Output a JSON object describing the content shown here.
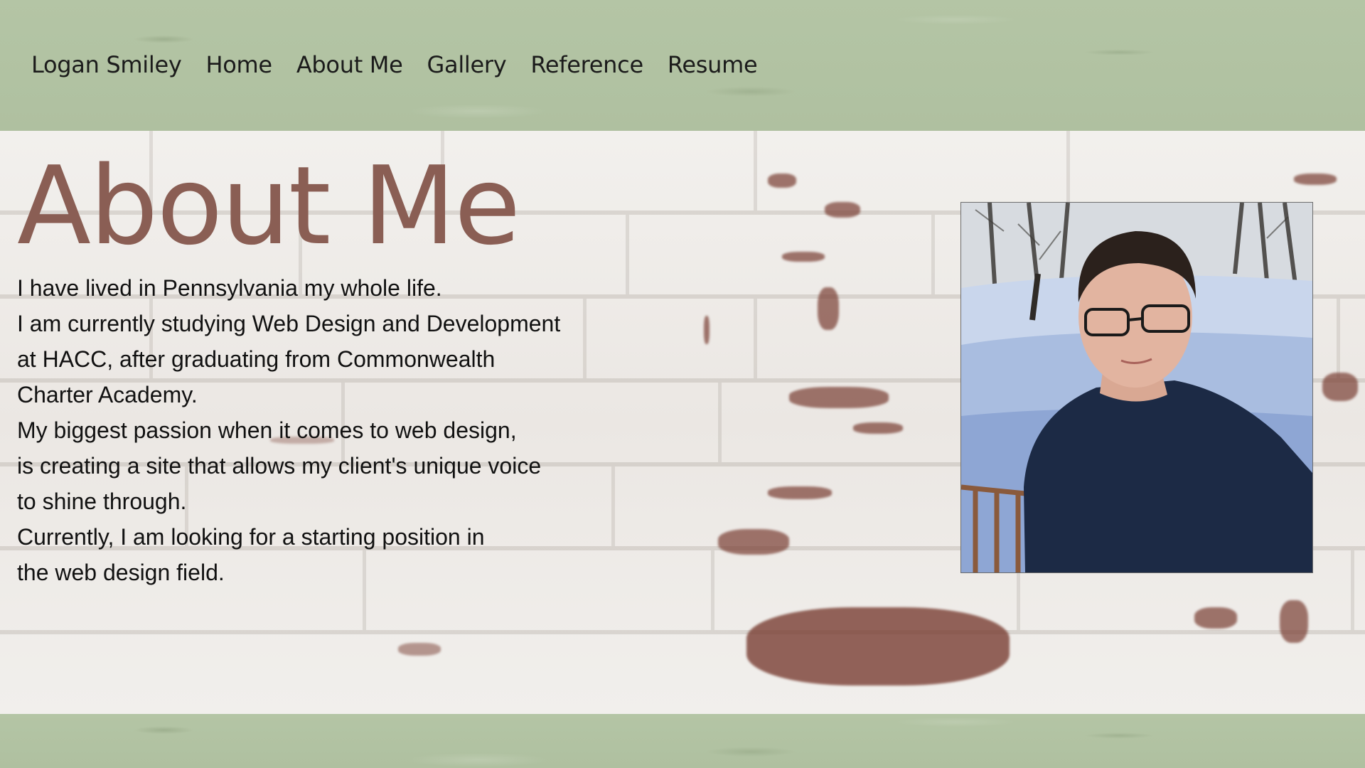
{
  "nav": {
    "items": [
      {
        "label": "Logan Smiley"
      },
      {
        "label": "Home"
      },
      {
        "label": "About Me"
      },
      {
        "label": "Gallery"
      },
      {
        "label": "Reference"
      },
      {
        "label": "Resume"
      }
    ]
  },
  "main": {
    "title": "About Me",
    "bio_lines": [
      "I have lived in Pennsylvania my whole life.",
      "I am currently studying Web Design and Development",
      "at HACC, after graduating from Commonwealth",
      "Charter Academy.",
      "My biggest passion when it comes to web design,",
      "is creating a site that allows my client's unique voice",
      "to shine through.",
      "Currently, I am looking for a starting position in",
      "the web design field."
    ],
    "photo_icon": "portrait-photo"
  },
  "colors": {
    "header_green": "#b3c4a4",
    "title_brown": "#8a5e54",
    "text": "#111111",
    "brick_white": "#efedea",
    "brick_stain": "#7a3f34"
  }
}
